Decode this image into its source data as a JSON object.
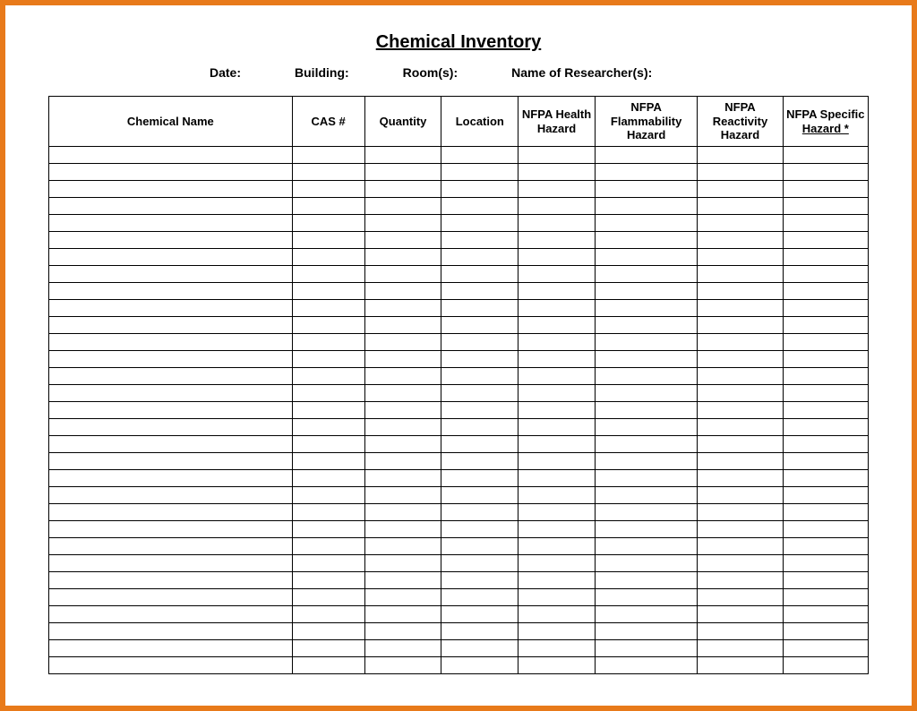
{
  "title": "Chemical Inventory",
  "meta": {
    "date_label": "Date:",
    "building_label": "Building:",
    "rooms_label": "Room(s):",
    "researcher_label": "Name of Researcher(s):"
  },
  "columns": {
    "chemical_name": "Chemical Name",
    "cas": "CAS #",
    "quantity": "Quantity",
    "location": "Location",
    "nfpa_health": "NFPA Health Hazard",
    "nfpa_flammability": "NFPA Flammability Hazard",
    "nfpa_reactivity": "NFPA Reactivity Hazard",
    "nfpa_specific_top": "NFPA Specific",
    "nfpa_specific_bottom": "Hazard *"
  },
  "row_count": 31
}
